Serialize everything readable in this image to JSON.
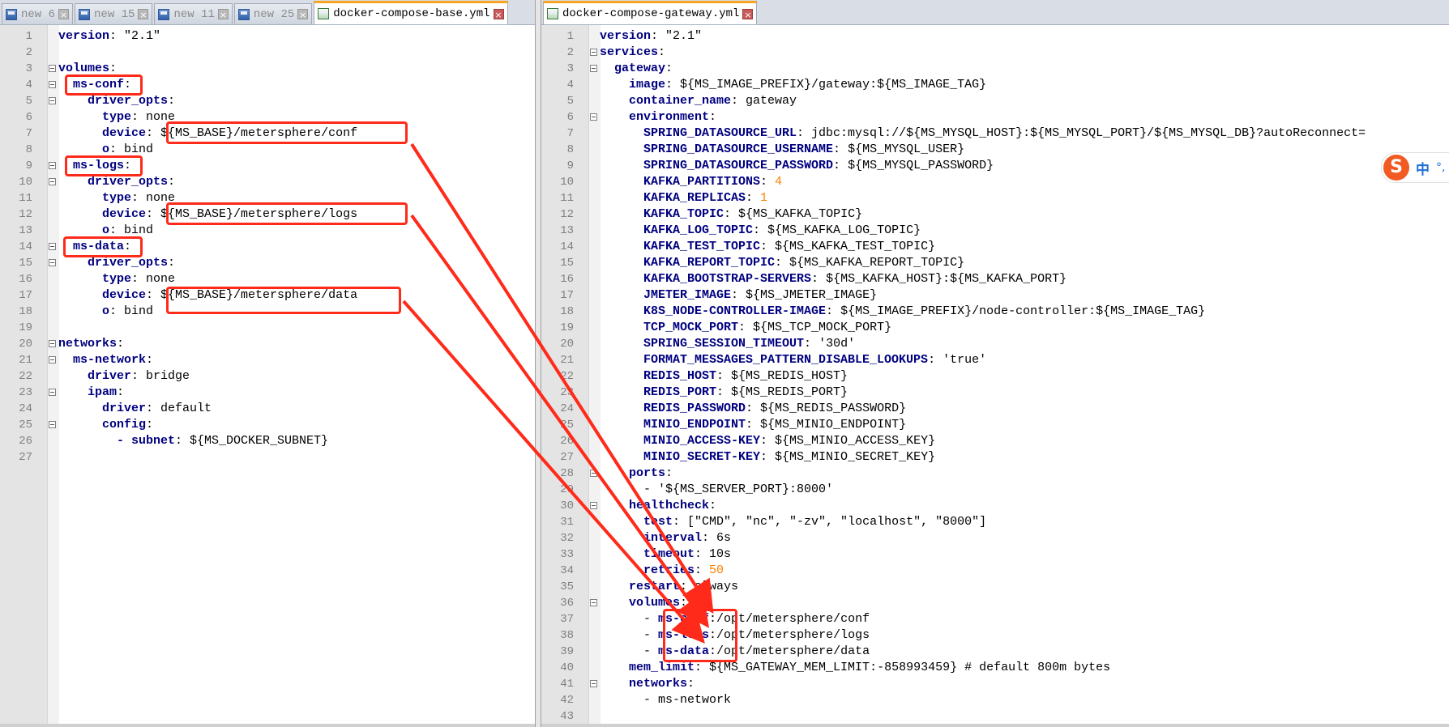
{
  "left": {
    "tabs": [
      {
        "label": "new 6",
        "active": false
      },
      {
        "label": "new 15",
        "active": false
      },
      {
        "label": "new 11",
        "active": false
      },
      {
        "label": "new 25",
        "active": false
      },
      {
        "label": "docker-compose-base.yml",
        "active": true
      }
    ],
    "lines": [
      {
        "n": "1",
        "fold": false,
        "indent": 0,
        "t": [
          [
            "k",
            "version"
          ],
          [
            "p",
            ": "
          ],
          [
            "v",
            "\"2.1\""
          ]
        ]
      },
      {
        "n": "2",
        "fold": false,
        "indent": 0,
        "t": []
      },
      {
        "n": "3",
        "fold": true,
        "indent": 0,
        "t": [
          [
            "k",
            "volumes"
          ],
          [
            "p",
            ":"
          ]
        ]
      },
      {
        "n": "4",
        "fold": true,
        "indent": 1,
        "t": [
          [
            "k",
            "ms-conf"
          ],
          [
            "p",
            ":"
          ]
        ]
      },
      {
        "n": "5",
        "fold": true,
        "indent": 2,
        "t": [
          [
            "k",
            "driver_opts"
          ],
          [
            "p",
            ":"
          ]
        ]
      },
      {
        "n": "6",
        "fold": false,
        "indent": 3,
        "t": [
          [
            "k",
            "type"
          ],
          [
            "p",
            ": "
          ],
          [
            "v",
            "none"
          ]
        ]
      },
      {
        "n": "7",
        "fold": false,
        "indent": 3,
        "t": [
          [
            "k",
            "device"
          ],
          [
            "p",
            ": "
          ],
          [
            "v",
            "${MS_BASE}/metersphere/conf"
          ]
        ]
      },
      {
        "n": "8",
        "fold": false,
        "indent": 3,
        "t": [
          [
            "k",
            "o"
          ],
          [
            "p",
            ": "
          ],
          [
            "v",
            "bind"
          ]
        ]
      },
      {
        "n": "9",
        "fold": true,
        "indent": 1,
        "t": [
          [
            "k",
            "ms-logs"
          ],
          [
            "p",
            ":"
          ]
        ]
      },
      {
        "n": "10",
        "fold": true,
        "indent": 2,
        "t": [
          [
            "k",
            "driver_opts"
          ],
          [
            "p",
            ":"
          ]
        ]
      },
      {
        "n": "11",
        "fold": false,
        "indent": 3,
        "t": [
          [
            "k",
            "type"
          ],
          [
            "p",
            ": "
          ],
          [
            "v",
            "none"
          ]
        ]
      },
      {
        "n": "12",
        "fold": false,
        "indent": 3,
        "t": [
          [
            "k",
            "device"
          ],
          [
            "p",
            ": "
          ],
          [
            "v",
            "${MS_BASE}/metersphere/logs"
          ]
        ]
      },
      {
        "n": "13",
        "fold": false,
        "indent": 3,
        "t": [
          [
            "k",
            "o"
          ],
          [
            "p",
            ": "
          ],
          [
            "v",
            "bind"
          ]
        ]
      },
      {
        "n": "14",
        "fold": true,
        "indent": 1,
        "t": [
          [
            "k",
            "ms-data"
          ],
          [
            "p",
            ":"
          ]
        ]
      },
      {
        "n": "15",
        "fold": true,
        "indent": 2,
        "t": [
          [
            "k",
            "driver_opts"
          ],
          [
            "p",
            ":"
          ]
        ]
      },
      {
        "n": "16",
        "fold": false,
        "indent": 3,
        "t": [
          [
            "k",
            "type"
          ],
          [
            "p",
            ": "
          ],
          [
            "v",
            "none"
          ]
        ]
      },
      {
        "n": "17",
        "fold": false,
        "indent": 3,
        "t": [
          [
            "k",
            "device"
          ],
          [
            "p",
            ": "
          ],
          [
            "v",
            "${MS_BASE}/metersphere/data"
          ]
        ]
      },
      {
        "n": "18",
        "fold": false,
        "indent": 3,
        "t": [
          [
            "k",
            "o"
          ],
          [
            "p",
            ": "
          ],
          [
            "v",
            "bind"
          ]
        ]
      },
      {
        "n": "19",
        "fold": false,
        "indent": 0,
        "t": []
      },
      {
        "n": "20",
        "fold": true,
        "indent": 0,
        "t": [
          [
            "k",
            "networks"
          ],
          [
            "p",
            ":"
          ]
        ]
      },
      {
        "n": "21",
        "fold": true,
        "indent": 1,
        "t": [
          [
            "k",
            "ms-network"
          ],
          [
            "p",
            ":"
          ]
        ]
      },
      {
        "n": "22",
        "fold": false,
        "indent": 2,
        "t": [
          [
            "k",
            "driver"
          ],
          [
            "p",
            ": "
          ],
          [
            "v",
            "bridge"
          ]
        ]
      },
      {
        "n": "23",
        "fold": true,
        "indent": 2,
        "t": [
          [
            "k",
            "ipam"
          ],
          [
            "p",
            ":"
          ]
        ]
      },
      {
        "n": "24",
        "fold": false,
        "indent": 3,
        "t": [
          [
            "k",
            "driver"
          ],
          [
            "p",
            ": "
          ],
          [
            "v",
            "default"
          ]
        ]
      },
      {
        "n": "25",
        "fold": true,
        "indent": 3,
        "t": [
          [
            "k",
            "config"
          ],
          [
            "p",
            ":"
          ]
        ]
      },
      {
        "n": "26",
        "fold": false,
        "indent": 4,
        "t": [
          [
            "k",
            "- subnet"
          ],
          [
            "p",
            ": "
          ],
          [
            "v",
            "${MS_DOCKER_SUBNET}"
          ]
        ]
      },
      {
        "n": "27",
        "fold": false,
        "indent": 0,
        "t": []
      }
    ]
  },
  "right": {
    "tabs": [
      {
        "label": "docker-compose-gateway.yml",
        "active": true
      }
    ],
    "lines": [
      {
        "n": "1",
        "fold": false,
        "indent": 0,
        "t": [
          [
            "k",
            "version"
          ],
          [
            "p",
            ": "
          ],
          [
            "v",
            "\"2.1\""
          ]
        ]
      },
      {
        "n": "2",
        "fold": true,
        "indent": 0,
        "t": [
          [
            "k",
            "services"
          ],
          [
            "p",
            ":"
          ]
        ]
      },
      {
        "n": "3",
        "fold": true,
        "indent": 1,
        "t": [
          [
            "k",
            "gateway"
          ],
          [
            "p",
            ":"
          ]
        ]
      },
      {
        "n": "4",
        "fold": false,
        "indent": 2,
        "t": [
          [
            "k",
            "image"
          ],
          [
            "p",
            ": "
          ],
          [
            "v",
            "${MS_IMAGE_PREFIX}/gateway:${MS_IMAGE_TAG}"
          ]
        ]
      },
      {
        "n": "5",
        "fold": false,
        "indent": 2,
        "t": [
          [
            "k",
            "container_name"
          ],
          [
            "p",
            ": "
          ],
          [
            "v",
            "gateway"
          ]
        ]
      },
      {
        "n": "6",
        "fold": true,
        "indent": 2,
        "t": [
          [
            "k",
            "environment"
          ],
          [
            "p",
            ":"
          ]
        ]
      },
      {
        "n": "7",
        "fold": false,
        "indent": 3,
        "t": [
          [
            "k",
            "SPRING_DATASOURCE_URL"
          ],
          [
            "p",
            ": "
          ],
          [
            "v",
            "jdbc:mysql://${MS_MYSQL_HOST}:${MS_MYSQL_PORT}/${MS_MYSQL_DB}?autoReconnect="
          ]
        ]
      },
      {
        "n": "8",
        "fold": false,
        "indent": 3,
        "t": [
          [
            "k",
            "SPRING_DATASOURCE_USERNAME"
          ],
          [
            "p",
            ": "
          ],
          [
            "v",
            "${MS_MYSQL_USER}"
          ]
        ]
      },
      {
        "n": "9",
        "fold": false,
        "indent": 3,
        "t": [
          [
            "k",
            "SPRING_DATASOURCE_PASSWORD"
          ],
          [
            "p",
            ": "
          ],
          [
            "v",
            "${MS_MYSQL_PASSWORD}"
          ]
        ]
      },
      {
        "n": "10",
        "fold": false,
        "indent": 3,
        "t": [
          [
            "k",
            "KAFKA_PARTITIONS"
          ],
          [
            "p",
            ": "
          ],
          [
            "n",
            "4"
          ]
        ]
      },
      {
        "n": "11",
        "fold": false,
        "indent": 3,
        "t": [
          [
            "k",
            "KAFKA_REPLICAS"
          ],
          [
            "p",
            ": "
          ],
          [
            "n",
            "1"
          ]
        ]
      },
      {
        "n": "12",
        "fold": false,
        "indent": 3,
        "t": [
          [
            "k",
            "KAFKA_TOPIC"
          ],
          [
            "p",
            ": "
          ],
          [
            "v",
            "${MS_KAFKA_TOPIC}"
          ]
        ]
      },
      {
        "n": "13",
        "fold": false,
        "indent": 3,
        "t": [
          [
            "k",
            "KAFKA_LOG_TOPIC"
          ],
          [
            "p",
            ": "
          ],
          [
            "v",
            "${MS_KAFKA_LOG_TOPIC}"
          ]
        ]
      },
      {
        "n": "14",
        "fold": false,
        "indent": 3,
        "t": [
          [
            "k",
            "KAFKA_TEST_TOPIC"
          ],
          [
            "p",
            ": "
          ],
          [
            "v",
            "${MS_KAFKA_TEST_TOPIC}"
          ]
        ]
      },
      {
        "n": "15",
        "fold": false,
        "indent": 3,
        "t": [
          [
            "k",
            "KAFKA_REPORT_TOPIC"
          ],
          [
            "p",
            ": "
          ],
          [
            "v",
            "${MS_KAFKA_REPORT_TOPIC}"
          ]
        ]
      },
      {
        "n": "16",
        "fold": false,
        "indent": 3,
        "t": [
          [
            "k",
            "KAFKA_BOOTSTRAP-SERVERS"
          ],
          [
            "p",
            ": "
          ],
          [
            "v",
            "${MS_KAFKA_HOST}:${MS_KAFKA_PORT}"
          ]
        ]
      },
      {
        "n": "17",
        "fold": false,
        "indent": 3,
        "t": [
          [
            "k",
            "JMETER_IMAGE"
          ],
          [
            "p",
            ": "
          ],
          [
            "v",
            "${MS_JMETER_IMAGE}"
          ]
        ]
      },
      {
        "n": "18",
        "fold": false,
        "indent": 3,
        "t": [
          [
            "k",
            "K8S_NODE-CONTROLLER-IMAGE"
          ],
          [
            "p",
            ": "
          ],
          [
            "v",
            "${MS_IMAGE_PREFIX}/node-controller:${MS_IMAGE_TAG}"
          ]
        ]
      },
      {
        "n": "19",
        "fold": false,
        "indent": 3,
        "t": [
          [
            "k",
            "TCP_MOCK_PORT"
          ],
          [
            "p",
            ": "
          ],
          [
            "v",
            "${MS_TCP_MOCK_PORT}"
          ]
        ]
      },
      {
        "n": "20",
        "fold": false,
        "indent": 3,
        "t": [
          [
            "k",
            "SPRING_SESSION_TIMEOUT"
          ],
          [
            "p",
            ": "
          ],
          [
            "v",
            "'30d'"
          ]
        ]
      },
      {
        "n": "21",
        "fold": false,
        "indent": 3,
        "t": [
          [
            "k",
            "FORMAT_MESSAGES_PATTERN_DISABLE_LOOKUPS"
          ],
          [
            "p",
            ": "
          ],
          [
            "v",
            "'true'"
          ]
        ]
      },
      {
        "n": "22",
        "fold": false,
        "indent": 3,
        "t": [
          [
            "k",
            "REDIS_HOST"
          ],
          [
            "p",
            ": "
          ],
          [
            "v",
            "${MS_REDIS_HOST}"
          ]
        ]
      },
      {
        "n": "23",
        "fold": false,
        "indent": 3,
        "t": [
          [
            "k",
            "REDIS_PORT"
          ],
          [
            "p",
            ": "
          ],
          [
            "v",
            "${MS_REDIS_PORT}"
          ]
        ]
      },
      {
        "n": "24",
        "fold": false,
        "indent": 3,
        "t": [
          [
            "k",
            "REDIS_PASSWORD"
          ],
          [
            "p",
            ": "
          ],
          [
            "v",
            "${MS_REDIS_PASSWORD}"
          ]
        ]
      },
      {
        "n": "25",
        "fold": false,
        "indent": 3,
        "t": [
          [
            "k",
            "MINIO_ENDPOINT"
          ],
          [
            "p",
            ": "
          ],
          [
            "v",
            "${MS_MINIO_ENDPOINT}"
          ]
        ]
      },
      {
        "n": "26",
        "fold": false,
        "indent": 3,
        "t": [
          [
            "k",
            "MINIO_ACCESS-KEY"
          ],
          [
            "p",
            ": "
          ],
          [
            "v",
            "${MS_MINIO_ACCESS_KEY}"
          ]
        ]
      },
      {
        "n": "27",
        "fold": false,
        "indent": 3,
        "t": [
          [
            "k",
            "MINIO_SECRET-KEY"
          ],
          [
            "p",
            ": "
          ],
          [
            "v",
            "${MS_MINIO_SECRET_KEY}"
          ]
        ]
      },
      {
        "n": "28",
        "fold": true,
        "indent": 2,
        "t": [
          [
            "k",
            "ports"
          ],
          [
            "p",
            ":"
          ]
        ]
      },
      {
        "n": "29",
        "fold": false,
        "indent": 3,
        "t": [
          [
            "p",
            "- "
          ],
          [
            "v",
            "'${MS_SERVER_PORT}:8000'"
          ]
        ]
      },
      {
        "n": "30",
        "fold": true,
        "indent": 2,
        "t": [
          [
            "k",
            "healthcheck"
          ],
          [
            "p",
            ":"
          ]
        ]
      },
      {
        "n": "31",
        "fold": false,
        "indent": 3,
        "t": [
          [
            "k",
            "test"
          ],
          [
            "p",
            ": "
          ],
          [
            "v",
            "[\"CMD\", \"nc\", \"-zv\", \"localhost\", \"8000\"]"
          ]
        ]
      },
      {
        "n": "32",
        "fold": false,
        "indent": 3,
        "t": [
          [
            "k",
            "interval"
          ],
          [
            "p",
            ": "
          ],
          [
            "v",
            "6s"
          ]
        ]
      },
      {
        "n": "33",
        "fold": false,
        "indent": 3,
        "t": [
          [
            "k",
            "timeout"
          ],
          [
            "p",
            ": "
          ],
          [
            "v",
            "10s"
          ]
        ]
      },
      {
        "n": "34",
        "fold": false,
        "indent": 3,
        "t": [
          [
            "k",
            "retries"
          ],
          [
            "p",
            ": "
          ],
          [
            "n",
            "50"
          ]
        ]
      },
      {
        "n": "35",
        "fold": false,
        "indent": 2,
        "t": [
          [
            "k",
            "restart"
          ],
          [
            "p",
            ": "
          ],
          [
            "v",
            "always"
          ]
        ]
      },
      {
        "n": "36",
        "fold": true,
        "indent": 2,
        "t": [
          [
            "k",
            "volumes"
          ],
          [
            "p",
            ":"
          ]
        ]
      },
      {
        "n": "37",
        "fold": false,
        "indent": 3,
        "t": [
          [
            "p",
            "- "
          ],
          [
            "k",
            "ms-conf"
          ],
          [
            "p",
            ":"
          ],
          [
            "v",
            "/opt/metersphere/conf"
          ]
        ]
      },
      {
        "n": "38",
        "fold": false,
        "indent": 3,
        "t": [
          [
            "p",
            "- "
          ],
          [
            "k",
            "ms-logs"
          ],
          [
            "p",
            ":"
          ],
          [
            "v",
            "/opt/metersphere/logs"
          ]
        ]
      },
      {
        "n": "39",
        "fold": false,
        "indent": 3,
        "t": [
          [
            "p",
            "- "
          ],
          [
            "k",
            "ms-data"
          ],
          [
            "p",
            ":"
          ],
          [
            "v",
            "/opt/metersphere/data"
          ]
        ]
      },
      {
        "n": "40",
        "fold": false,
        "indent": 2,
        "t": [
          [
            "k",
            "mem_limit"
          ],
          [
            "p",
            ": "
          ],
          [
            "v",
            "${MS_GATEWAY_MEM_LIMIT:-858993459} # default 800m bytes"
          ]
        ]
      },
      {
        "n": "41",
        "fold": true,
        "indent": 2,
        "t": [
          [
            "k",
            "networks"
          ],
          [
            "p",
            ":"
          ]
        ]
      },
      {
        "n": "42",
        "fold": false,
        "indent": 3,
        "t": [
          [
            "p",
            "- "
          ],
          [
            "v",
            "ms-network"
          ]
        ]
      },
      {
        "n": "43",
        "fold": false,
        "indent": 0,
        "t": []
      }
    ]
  },
  "ime": {
    "logo": "S",
    "label": "中",
    "extra": "°,"
  },
  "colors": {
    "annotation": "#ff2a1a",
    "key": "#000080",
    "number": "#ff8000"
  }
}
